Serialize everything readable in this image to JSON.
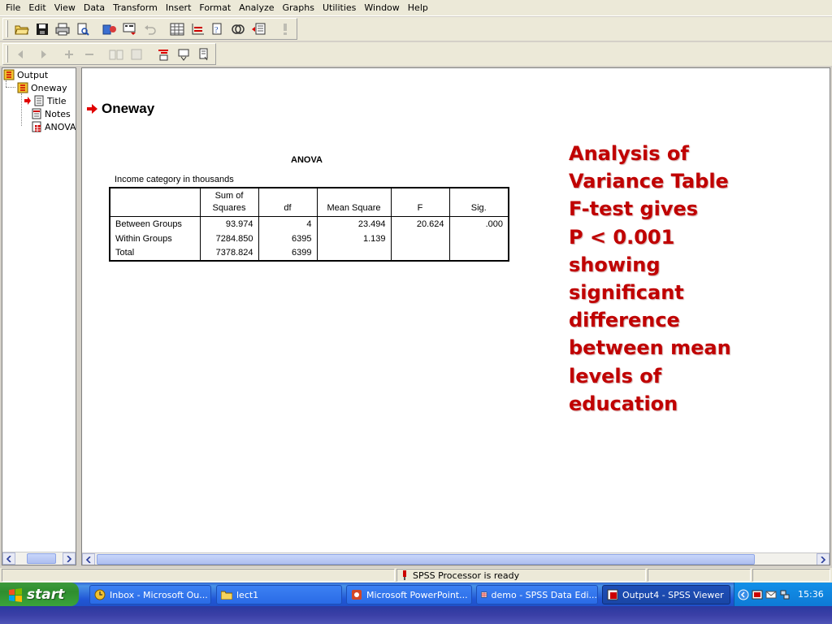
{
  "menu": [
    "File",
    "Edit",
    "View",
    "Data",
    "Transform",
    "Insert",
    "Format",
    "Analyze",
    "Graphs",
    "Utilities",
    "Window",
    "Help"
  ],
  "outline": {
    "root": "Output",
    "procedure": "Oneway",
    "items": [
      "Title",
      "Notes",
      "ANOVA"
    ]
  },
  "viewer": {
    "heading": "Oneway",
    "table_title": "ANOVA",
    "table_caption": "Income category in thousands",
    "headers": [
      "",
      "Sum of Squares",
      "df",
      "Mean Square",
      "F",
      "Sig."
    ],
    "rows": [
      [
        "Between Groups",
        "93.974",
        "4",
        "23.494",
        "20.624",
        ".000"
      ],
      [
        "Within Groups",
        "7284.850",
        "6395",
        "1.139",
        "",
        ""
      ],
      [
        "Total",
        "7378.824",
        "6399",
        "",
        "",
        ""
      ]
    ]
  },
  "annotation": {
    "lines": [
      "Analysis of",
      "Variance Table",
      "F-test gives",
      "P < 0.001",
      "showing",
      "significant",
      "difference",
      "between mean",
      "levels of",
      "education"
    ],
    "color": "#c00000"
  },
  "status": {
    "processor": "SPSS Processor  is ready"
  },
  "taskbar": {
    "start": "start",
    "tasks": [
      "Inbox - Microsoft Ou...",
      "lect1",
      "Microsoft PowerPoint...",
      "demo - SPSS Data Edi...",
      "Output4 - SPSS Viewer"
    ],
    "active_task": "Output4 - SPSS Viewer",
    "clock": "15:36"
  }
}
